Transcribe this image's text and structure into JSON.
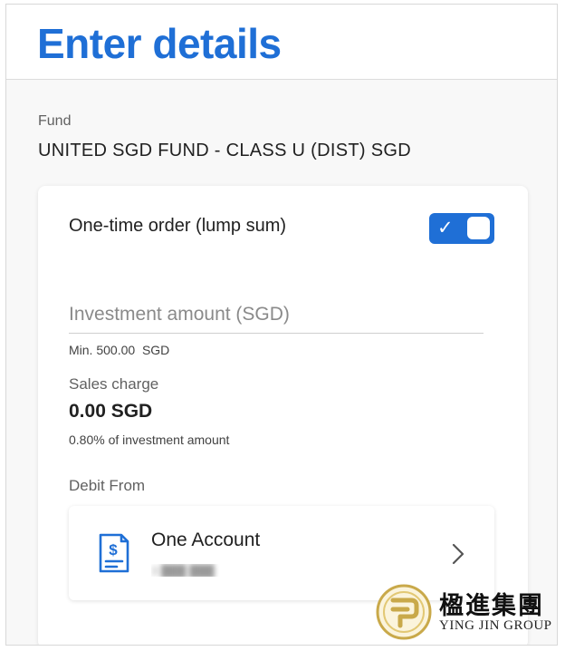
{
  "header": {
    "title": "Enter details"
  },
  "fund": {
    "label": "Fund",
    "name": "UNITED SGD FUND - CLASS U (DIST) SGD"
  },
  "order": {
    "label": "One-time order (lump sum)",
    "toggle_on": true,
    "toggle_check_glyph": "✓"
  },
  "investment": {
    "placeholder": "Investment amount (SGD)",
    "value": "",
    "min_text": "Min. 500.00  SGD"
  },
  "sales_charge": {
    "label": "Sales charge",
    "value": "0.00 SGD",
    "note": "0.80% of investment amount"
  },
  "debit": {
    "label": "Debit From",
    "account_name": "One Account",
    "account_number_masked": "3 ███ ███",
    "account_icon": "account-document-dollar-icon",
    "chevron_icon": "chevron-right-icon"
  },
  "watermark": {
    "chinese": "楹進集團",
    "english": "YING JIN GROUP"
  },
  "colors": {
    "accent": "#1f6fd6",
    "gold": "#c9a94a"
  }
}
